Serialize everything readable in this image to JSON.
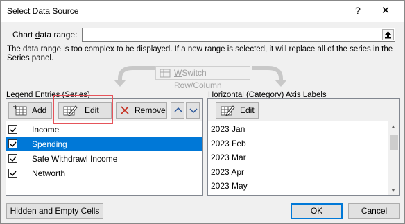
{
  "dialog": {
    "title": "Select Data Source",
    "help_label": "?",
    "close_label": "✕"
  },
  "range": {
    "label_prefix": "Chart ",
    "label_accel": "d",
    "label_suffix": "ata range:",
    "value": "",
    "collapse_icon": "collapse-arrow-icon"
  },
  "message": "The data range is too complex to be displayed. If a new range is selected, it will replace all of the series in the Series panel.",
  "switch_button": {
    "label_accel": "W",
    "label_rest": "Switch Row/Column"
  },
  "legend": {
    "label": "Legend Entries (Series)",
    "add_label": "Add",
    "edit_label": "Edit",
    "remove_label": "Remove",
    "series": [
      {
        "name": "Income",
        "checked": true,
        "selected": false
      },
      {
        "name": "Spending",
        "checked": true,
        "selected": true
      },
      {
        "name": "Safe Withdrawl Income",
        "checked": true,
        "selected": false
      },
      {
        "name": "Networth",
        "checked": true,
        "selected": false
      }
    ]
  },
  "axis": {
    "label": "Horizontal (Category) Axis Labels",
    "edit_label": "Edit",
    "labels": [
      "2023 Jan",
      "2023 Feb",
      "2023 Mar",
      "2023 Apr",
      "2023 May"
    ]
  },
  "footer": {
    "hidden_label": "Hidden and Empty Cells",
    "ok_label": "OK",
    "cancel_label": "Cancel"
  },
  "colors": {
    "selection": "#0078d7",
    "highlight": "#e5545b",
    "remove_x": "#c42b1c",
    "updown_arrow": "#2b579a"
  }
}
